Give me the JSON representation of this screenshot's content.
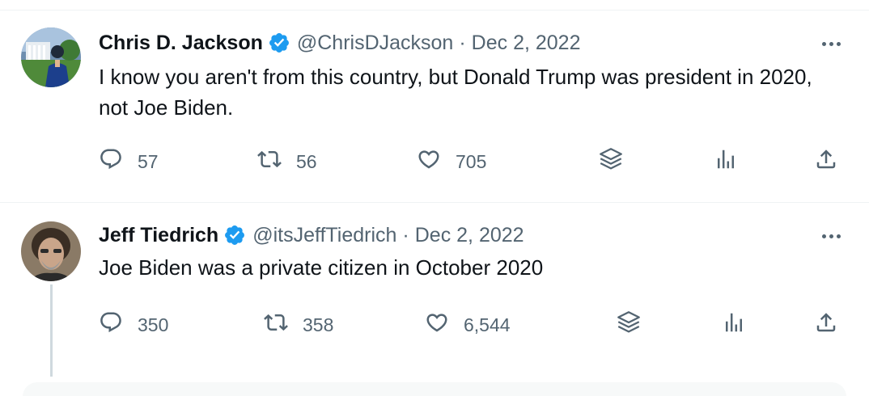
{
  "tweets": [
    {
      "name": "Chris D. Jackson",
      "handle": "@ChrisDJackson",
      "separator": "·",
      "date": "Dec 2, 2022",
      "text": "I know you aren't from this country, but Donald Trump was president in 2020, not Joe Biden.",
      "verified": true,
      "replies": "57",
      "retweets": "56",
      "likes": "705"
    },
    {
      "name": "Jeff Tiedrich",
      "handle": "@itsJeffTiedrich",
      "separator": "·",
      "date": "Dec 2, 2022",
      "text": "Joe Biden was a private citizen in October 2020",
      "verified": true,
      "replies": "350",
      "retweets": "358",
      "likes": "6,544"
    }
  ],
  "icons": {
    "reply": "reply-bubble-icon",
    "retweet": "retweet-icon",
    "like": "heart-icon",
    "stack": "layers-icon",
    "views": "analytics-icon",
    "share": "share-icon",
    "more": "more-dots-icon",
    "verified": "verified-badge-icon"
  },
  "colors": {
    "verified": "#1d9bf0",
    "text": "#0f1419",
    "secondary": "#536471",
    "divider": "#eff3f4"
  }
}
